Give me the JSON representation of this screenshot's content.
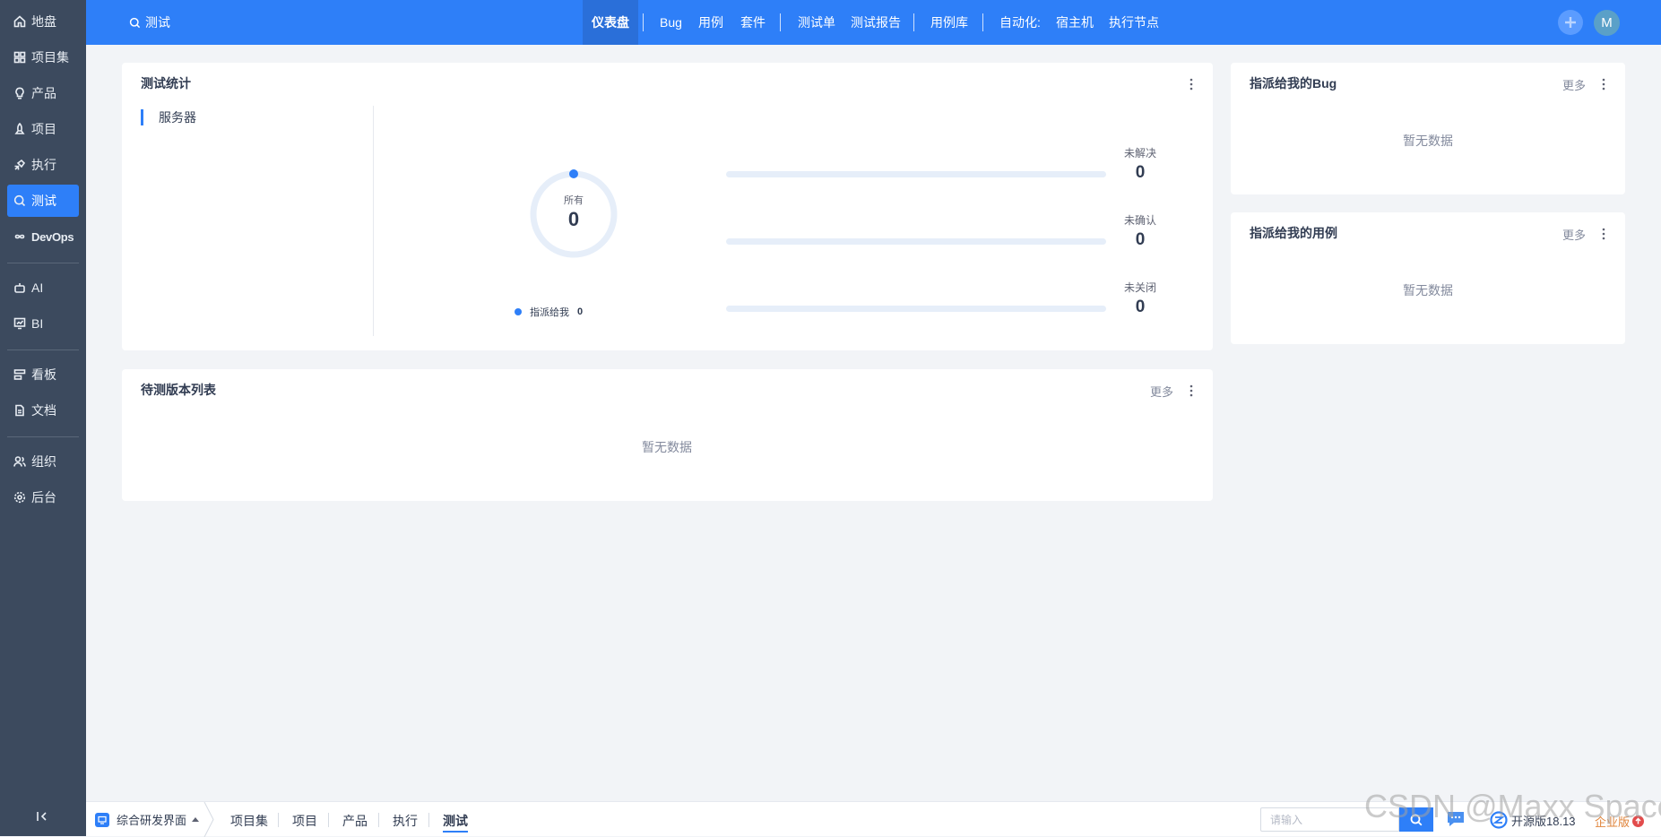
{
  "sidebar": {
    "items": [
      {
        "label": "地盘",
        "icon": "home-icon"
      },
      {
        "label": "项目集",
        "icon": "grid-icon"
      },
      {
        "label": "产品",
        "icon": "lightbulb-icon"
      },
      {
        "label": "项目",
        "icon": "rocket-icon"
      },
      {
        "label": "执行",
        "icon": "run-icon"
      },
      {
        "label": "测试",
        "icon": "bug-search-icon",
        "active": true
      },
      {
        "label": "DevOps",
        "icon": "infinity-icon"
      },
      {
        "label": "AI",
        "icon": "robot-icon"
      },
      {
        "label": "BI",
        "icon": "chart-board-icon"
      },
      {
        "label": "看板",
        "icon": "kanban-icon"
      },
      {
        "label": "文档",
        "icon": "document-icon"
      },
      {
        "label": "组织",
        "icon": "people-icon"
      },
      {
        "label": "后台",
        "icon": "settings-icon"
      }
    ]
  },
  "header": {
    "breadcrumb": "测试",
    "nav": {
      "dashboard": "仪表盘",
      "bug": "Bug",
      "case": "用例",
      "suite": "套件",
      "testtask": "测试单",
      "report": "测试报告",
      "caselib": "用例库",
      "automation": "自动化:",
      "host": "宿主机",
      "node": "执行节点"
    },
    "avatar": "M"
  },
  "test_stats": {
    "title": "测试统计",
    "tab": "服务器",
    "donut_label": "所有",
    "donut_value": "0",
    "legend_label": "指派给我",
    "legend_value": "0",
    "rows": [
      {
        "label": "未解决",
        "value": "0",
        "fill": 0
      },
      {
        "label": "未确认",
        "value": "0",
        "fill": 0
      },
      {
        "label": "未关闭",
        "value": "0",
        "fill": 0
      }
    ]
  },
  "builds": {
    "title": "待测版本列表",
    "more": "更多",
    "empty": "暂无数据"
  },
  "my_bugs": {
    "title": "指派给我的Bug",
    "more": "更多",
    "empty": "暂无数据"
  },
  "my_cases": {
    "title": "指派给我的用例",
    "more": "更多",
    "empty": "暂无数据"
  },
  "footer": {
    "workspace": "综合研发界面",
    "tabs": [
      "项目集",
      "项目",
      "产品",
      "执行",
      "测试"
    ],
    "active_tab": "测试",
    "search_placeholder": "请输入",
    "version": "开源版18.13",
    "enterprise": "企业版"
  },
  "watermark": "CSDN @Maxx Space",
  "colors": {
    "primary": "#2e7ff8",
    "sidebar": "#3c4a5e",
    "background": "#f2f4f7"
  }
}
